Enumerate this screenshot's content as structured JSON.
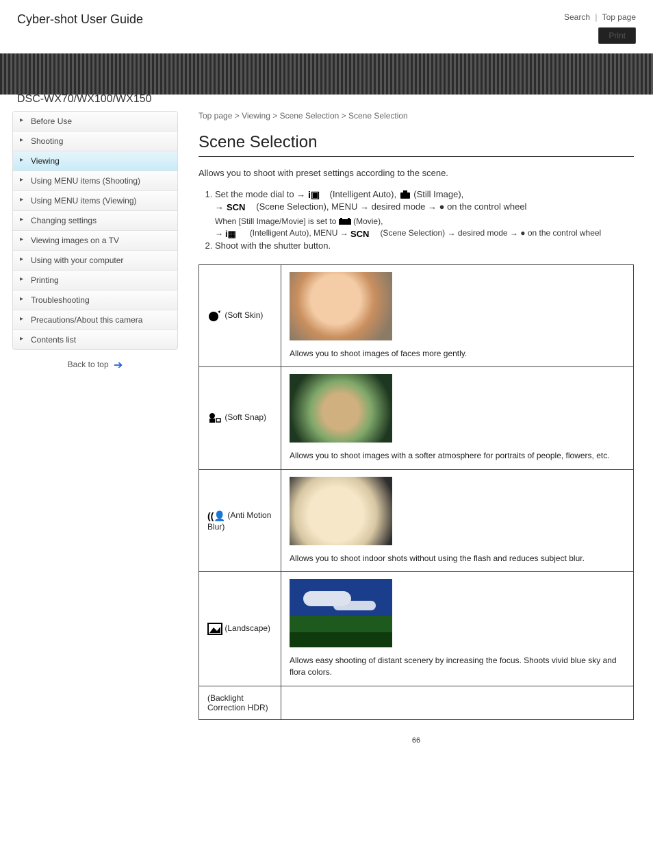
{
  "header": {
    "guide_title": "Cyber-shot User Guide",
    "top_link": "Top page",
    "print_label": "Print",
    "search_label": "Search"
  },
  "subhead": "DSC-WX70/WX100/WX150",
  "sidebar": {
    "items": [
      {
        "label": "Before Use"
      },
      {
        "label": "Shooting"
      },
      {
        "label": "Viewing"
      },
      {
        "label": "Using MENU items (Shooting)"
      },
      {
        "label": "Using MENU items (Viewing)"
      },
      {
        "label": "Changing settings"
      },
      {
        "label": "Viewing images on a TV"
      },
      {
        "label": "Using with your computer"
      },
      {
        "label": "Printing"
      },
      {
        "label": "Troubleshooting"
      },
      {
        "label": "Precautions/About this camera"
      },
      {
        "label": "Contents list"
      }
    ],
    "active_index": 2,
    "backtop": "Back to top"
  },
  "breadcrumb": {
    "top": "Top page",
    "cat": "Viewing",
    "sub": "Scene Selection",
    "leaf": "Scene Selection"
  },
  "page": {
    "title": "Scene Selection",
    "intro": "Allows you to shoot with preset settings according to the scene.",
    "step1_prefix": "Set the mode dial to ",
    "step1_ia": " (Intelligent Auto), ",
    "step1_still": " (Still Image), ",
    "step1_scn": " (Scene Selection), MENU ",
    "step1_desired": " desired mode ",
    "step1_center": " on the control wheel",
    "alt1a": "When [Still Image/Movie] is set to ",
    "alt1b": " (Movie), ",
    "alt2": " (Intelligent Auto), MENU ",
    "alt3": " (Scene Selection) ",
    "alt4": " desired mode ",
    "alt5": " on the control wheel",
    "step2": "Shoot with the shutter button.",
    "foot": "66"
  },
  "modes": [
    {
      "key": "soft_skin",
      "label": " (Soft Skin)",
      "desc": "Allows you to shoot images of faces more gently."
    },
    {
      "key": "soft_snap",
      "label": " (Soft Snap)",
      "desc": "Allows you to shoot images with a softer atmosphere for portraits of people, flowers, etc."
    },
    {
      "key": "anti_blur",
      "label": " (Anti Motion Blur)",
      "desc": "Allows you to shoot indoor shots without using the flash and reduces subject blur."
    },
    {
      "key": "landscape",
      "label": " (Landscape)",
      "desc": "Allows easy shooting of distant scenery by increasing the focus. Shoots vivid blue sky and flora colors."
    },
    {
      "key": "bl_portrait",
      "label": " (Backlight Correction HDR)",
      "desc": ""
    }
  ]
}
